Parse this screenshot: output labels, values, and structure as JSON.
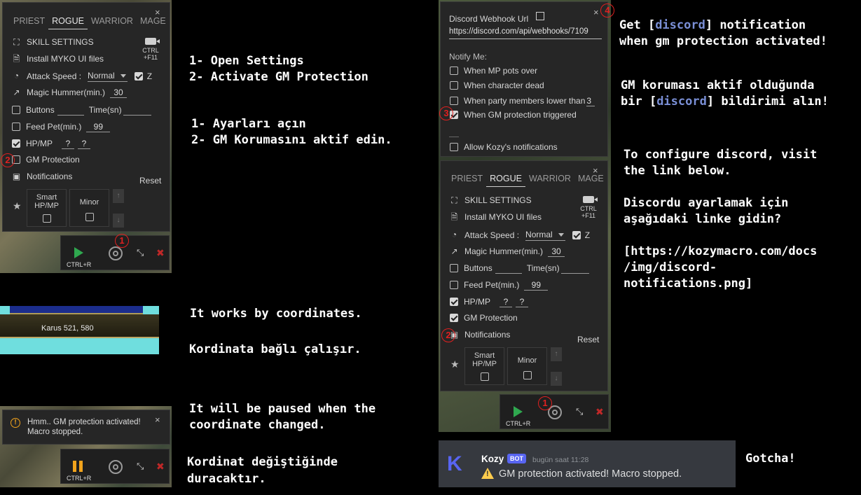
{
  "settings": {
    "tabs": [
      "PRIEST",
      "ROGUE",
      "WARRIOR",
      "MAGE"
    ],
    "active_tab": "ROGUE",
    "close": "×",
    "skill_settings": "SKILL SETTINGS",
    "shortcut_top": "CTRL",
    "shortcut_bottom": "+F11",
    "install_ui": "Install MYKO UI files",
    "attack_speed_label": "Attack Speed :",
    "attack_speed_value": "Normal",
    "z_label": "Z",
    "magic_hummer_label": "Magic Hummer(min.)",
    "magic_hummer_value": "30",
    "buttons_label": "Buttons",
    "time_label": "Time(sn)",
    "feed_pet_label": "Feed Pet(min.)",
    "feed_pet_value": "99",
    "hpmp_label": "HP/MP",
    "hpmp_q1": "?",
    "hpmp_q2": "?",
    "gm_protection_label": "GM Protection",
    "notifications_label": "Notifications",
    "reset_label": "Reset",
    "smart_label_1": "Smart",
    "smart_label_2": "HP/MP",
    "minor_label": "Minor"
  },
  "toolbar": {
    "run_shortcut": "CTRL+R"
  },
  "webhook": {
    "title": "Discord Webhook Url",
    "url": "https://discord.com/api/webhooks/7109",
    "notify_me": "Notify Me:",
    "opt_mp": "When MP pots over",
    "opt_dead": "When character dead",
    "opt_party": "When party members lower than",
    "opt_party_value": "3",
    "opt_gm": "When GM protection triggered",
    "opt_kozy": "Allow Kozy's notifications"
  },
  "badges": {
    "one": "1",
    "two": "2",
    "three": "3",
    "four": "4"
  },
  "coords": {
    "location": "Karus 521, 580"
  },
  "toast": {
    "line1": "Hmm.. GM protection activated!",
    "line2": "Macro stopped."
  },
  "discord_msg": {
    "avatar_letter": "K",
    "author": "Kozy",
    "bot_tag": "BOT",
    "time": "bugün saat 11:28",
    "text": "GM protection activated! Macro stopped."
  },
  "instructions": {
    "en_steps_1": "1- Open Settings",
    "en_steps_2": "2- Activate GM Protection",
    "tr_steps_1": "1- Ayarları açın",
    "tr_steps_2": "2- GM Korumasını aktif edin.",
    "coord_en": "It works by coordinates.",
    "coord_tr": "Kordinata bağlı çalışır.",
    "pause_en_1": "It will be paused when the",
    "pause_en_2": "coordinate changed.",
    "pause_tr_1": "Kordinat değiştiğinde",
    "pause_tr_2": "duracaktır.",
    "notify_en_1a": "Get [",
    "notify_en_1b": "discord",
    "notify_en_1c": "] notification",
    "notify_en_2": "when gm protection activated!",
    "notify_tr_1": "GM koruması aktif olduğunda",
    "notify_tr_2a": "bir [",
    "notify_tr_2b": "discord",
    "notify_tr_2c": "] bildirimi alın!",
    "config_en_1": "To configure discord, visit",
    "config_en_2": "the link below.",
    "config_tr_1": "Discordu ayarlamak için",
    "config_tr_2": "aşağıdaki linke gidin?",
    "link_1": "[https://kozymacro.com/docs",
    "link_2": "/img/discord-",
    "link_3": "notifications.png]",
    "gotcha": "Gotcha!"
  },
  "colors": {
    "discord_blue": "#5865f2",
    "link_blue": "#7289da",
    "badge_red": "#e02020"
  }
}
